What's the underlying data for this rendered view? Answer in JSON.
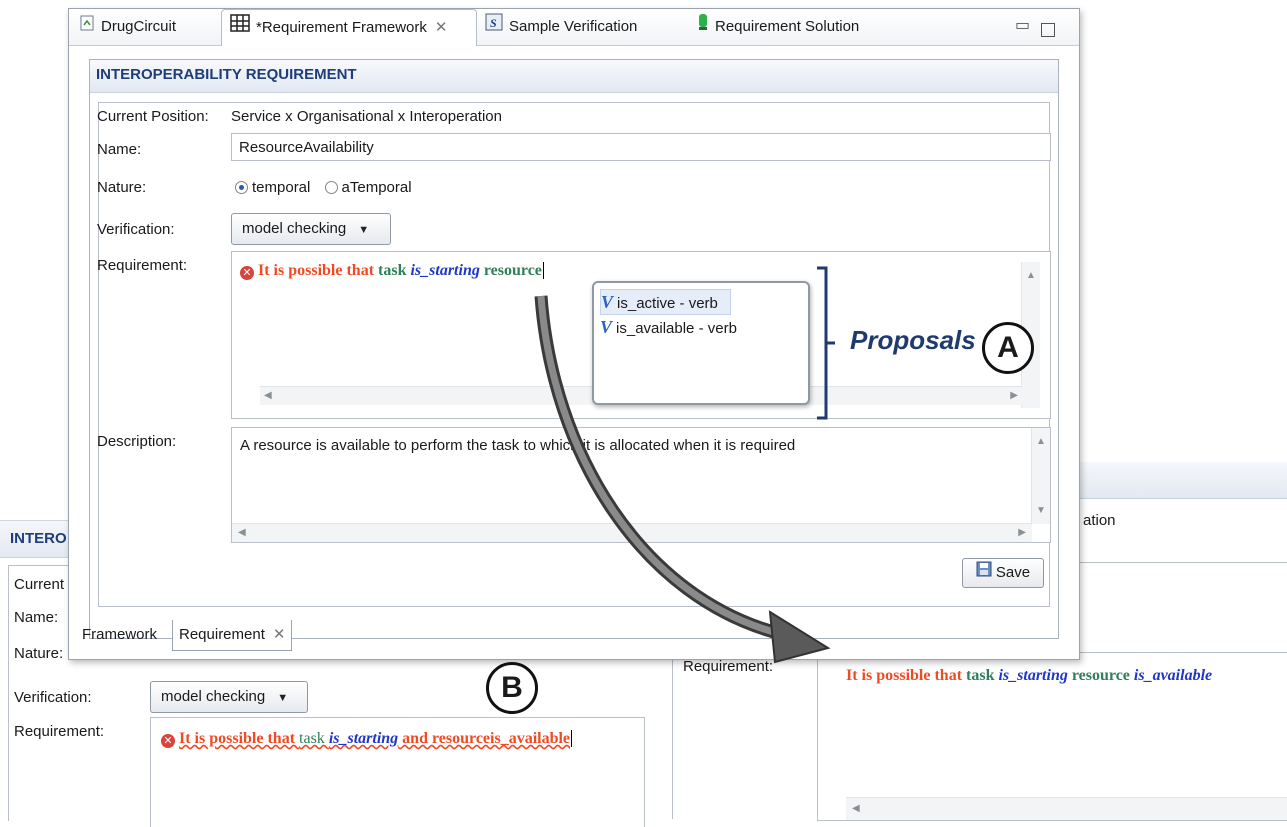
{
  "bg_left": {
    "section_header": "INTERO",
    "current_label": "Current",
    "name_label": "Name:",
    "nature_label": "Nature:",
    "verification_label": "Verification:",
    "verification_value": "model checking",
    "requirement_label": "Requirement:",
    "requirement_text": "It is possible that task is_starting and resourceis_available",
    "requirement_parts": {
      "p1": "It is possible that ",
      "task": "task ",
      "verb": "is_starting",
      "rest": " and resourceis_available"
    }
  },
  "bg_right": {
    "partial_text": "ation",
    "requirement_label": "Requirement:",
    "requirement_parts": {
      "p1": "It is possible that ",
      "task": "task ",
      "verb1": "is_starting",
      "resource": " resource ",
      "verb2": "is_available"
    }
  },
  "main": {
    "tabs": [
      {
        "label": "DrugCircuit",
        "icon": "document-icon"
      },
      {
        "label": "*Requirement Framework",
        "icon": "grid-icon"
      },
      {
        "label": "Sample Verification",
        "icon": "s-file-icon"
      },
      {
        "label": "Requirement Solution",
        "icon": "green-bar-icon"
      }
    ],
    "section_header": "INTEROPERABILITY REQUIREMENT",
    "current_position_label": "Current Position:",
    "current_position_value": "Service x Organisational x Interoperation",
    "name_label": "Name:",
    "name_value": "ResourceAvailability",
    "nature_label": "Nature:",
    "nature_options": [
      "temporal",
      "aTemporal"
    ],
    "nature_selected": "temporal",
    "verification_label": "Verification:",
    "verification_value": "model checking",
    "requirement_label": "Requirement:",
    "requirement_parts": {
      "p1": "It is possible that ",
      "task": "task ",
      "verb": "is_starting",
      "resource": " resource"
    },
    "proposals": [
      {
        "letter": "V",
        "label": "is_active - verb"
      },
      {
        "letter": "V",
        "label": "is_available - verb"
      }
    ],
    "description_label": "Description:",
    "description_value": "A resource is available to perform the task to which it is allocated when it is required",
    "save_label": "Save",
    "bottom_tabs": [
      "Framework",
      "Requirement"
    ]
  },
  "annotations": {
    "proposals": "Proposals",
    "circle_a": "A",
    "circle_b": "B"
  },
  "colors": {
    "keyword_red": "#ef4a23",
    "noun_green": "#2f7f5a",
    "verb_blue": "#1f36c8",
    "header_blue": "#1f3d7a"
  }
}
